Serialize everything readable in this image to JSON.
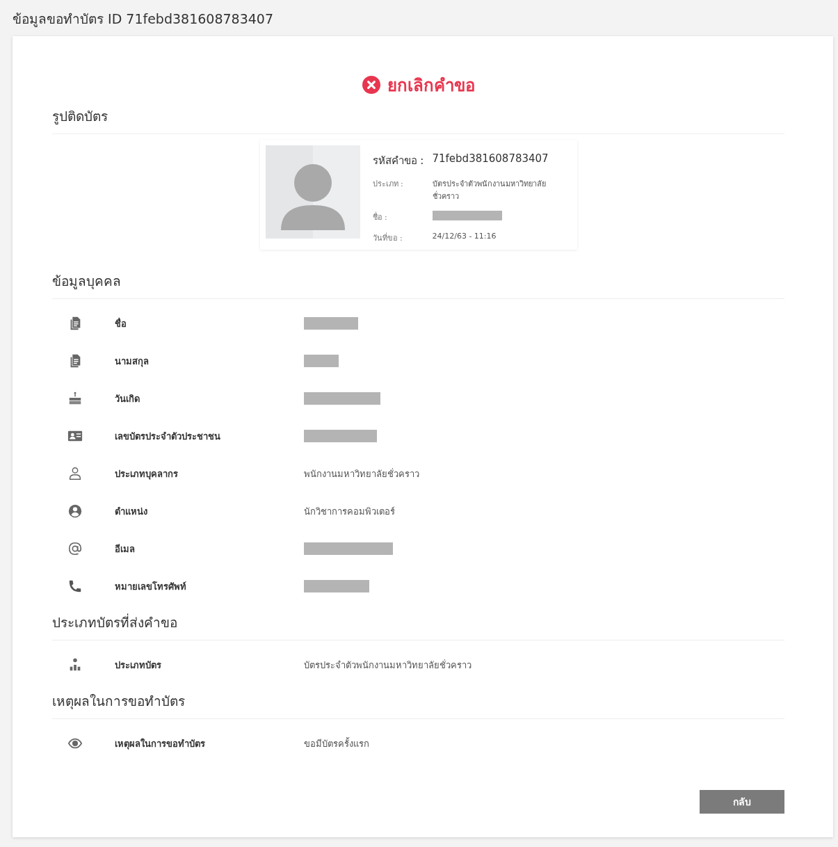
{
  "page_title": "ข้อมูลขอทำบัตร ID 71febd381608783407",
  "status": {
    "kind": "cancelled",
    "label": "ยกเลิกคำขอ"
  },
  "photo_section": {
    "title": "รูปติดบัตร",
    "summary": [
      {
        "label": "รหัสคำขอ :",
        "kind": "text",
        "value": "71febd381608783407"
      },
      {
        "label": "ประเภท :",
        "kind": "text",
        "value": "บัตรประจำตัวพนักงานมหาวิทยาลัยชั่วคราว"
      },
      {
        "label": "ชื่อ :",
        "kind": "redacted"
      },
      {
        "label": "วันที่ขอ :",
        "kind": "text",
        "value": "24/12/63 - 11:16"
      }
    ]
  },
  "sections": [
    {
      "title": "ข้อมูลบุคคล",
      "rows": [
        {
          "label": "ชื่อ",
          "kind": "redacted"
        },
        {
          "label": "นามสกุล",
          "kind": "redacted"
        },
        {
          "label": "วันเกิด",
          "kind": "redacted"
        },
        {
          "label": "เลขบัตรประจำตัวประชาชน",
          "kind": "redacted"
        },
        {
          "label": "ประเภทบุคลากร",
          "kind": "text",
          "value": "พนักงานมหาวิทยาลัยชั่วคราว"
        },
        {
          "label": "ตำแหน่ง",
          "kind": "text",
          "value": "นักวิชาการคอมพิวเตอร์"
        },
        {
          "label": "อีเมล",
          "kind": "redacted"
        },
        {
          "label": "หมายเลขโทรศัพท์",
          "kind": "redacted"
        }
      ]
    },
    {
      "title": "ประเภทบัตรที่ส่งคำขอ",
      "rows": [
        {
          "label": "ประเภทบัตร",
          "kind": "text",
          "value": "บัตรประจำตัวพนักงานมหาวิทยาลัยชั่วคราว"
        }
      ]
    },
    {
      "title": "เหตุผลในการขอทำบัตร",
      "rows": [
        {
          "label": "เหตุผลในการขอทำบัตร",
          "kind": "text",
          "value": "ขอมีบัตรครั้งแรก"
        }
      ]
    }
  ],
  "back_button": "กลับ"
}
